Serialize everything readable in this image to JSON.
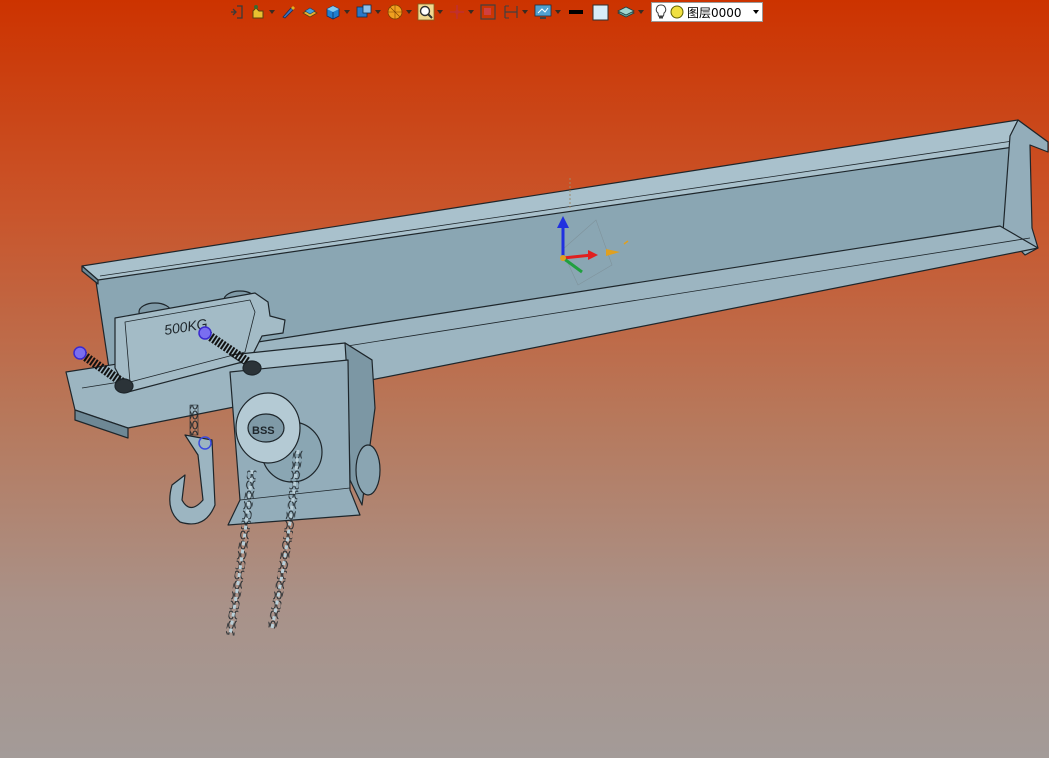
{
  "toolbar": {
    "layer": {
      "name": "图层0000"
    }
  },
  "model": {
    "trolley_label": "500KG",
    "hub_label": "BSS"
  },
  "colors": {
    "steel": "#8fa9b6",
    "steel_light": "#a8c0cb",
    "steel_dark": "#6e8895",
    "edge": "#1e262b",
    "axis_x": "#e02020",
    "axis_y": "#20a040",
    "axis_z": "#2030e0",
    "bg_top": "#cc3300",
    "bg_bottom": "#a39b98"
  }
}
